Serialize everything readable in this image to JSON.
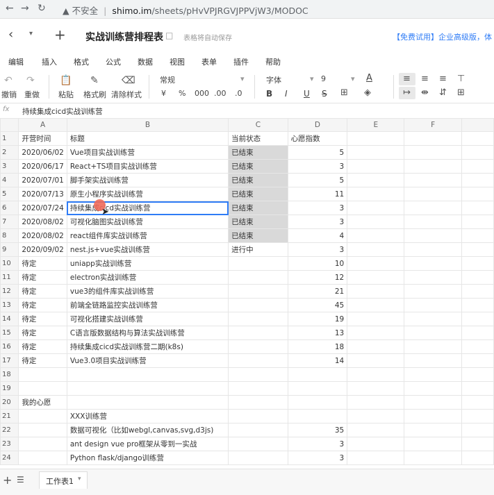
{
  "browser": {
    "back_icon": "arrow-left",
    "forward_icon": "arrow-right",
    "reload_icon": "reload",
    "security_icon": "warning",
    "security_label": "不安全",
    "separator": "|",
    "url_host": "shimo.im",
    "url_path": "/sheets/pHvVPJRGVJPPVjW3/MODOC"
  },
  "doc": {
    "back": "‹",
    "dropdown": "▾",
    "add": "+",
    "title": "实战训练营排程表",
    "autosave": "表格将自动保存",
    "promo": "【免费试用】企业高级版，体"
  },
  "menu": [
    "编辑",
    "插入",
    "格式",
    "公式",
    "数据",
    "视图",
    "表单",
    "插件",
    "帮助"
  ],
  "toolbar": {
    "undo": "撤销",
    "redo": "重做",
    "paste": "粘贴",
    "format_painter": "格式刷",
    "clear_format": "清除样式",
    "number_format": "常规",
    "currency": "¥",
    "percent": "%",
    "thousands": "000",
    "dec_less": ".00",
    "dec_more": ".0",
    "font": "字体",
    "font_size": "9",
    "bold": "B",
    "italic": "I",
    "underline": "U",
    "strike": "S",
    "font_color": "A"
  },
  "formula": {
    "fx": "fx",
    "content": "持续集成cicd实战训练营"
  },
  "columns": [
    "A",
    "B",
    "C",
    "D",
    "E",
    "F"
  ],
  "rows": [
    {
      "n": "1",
      "a": "开营时间",
      "b": "标题",
      "c": "当前状态",
      "d": "心愿指数"
    },
    {
      "n": "2",
      "a": "2020/06/02",
      "b": " Vue项目实战训练营",
      "c": "已结束",
      "d": "5"
    },
    {
      "n": "3",
      "a": "2020/06/17",
      "b": "React+TS项目实战训练营",
      "c": "已结束",
      "d": "3"
    },
    {
      "n": "4",
      "a": "2020/07/01",
      "b": "脚手架实战训练营",
      "c": "已结束",
      "d": "5"
    },
    {
      "n": "5",
      "a": "2020/07/13",
      "b": "原生小程序实战训练营",
      "c": "已结束",
      "d": "11"
    },
    {
      "n": "6",
      "a": "2020/07/24",
      "b": "持续集成cicd实战训练营",
      "c": "已结束",
      "d": "3"
    },
    {
      "n": "7",
      "a": "2020/08/02",
      "b": "可视化脑图实战训练营",
      "c": "已结束",
      "d": "3"
    },
    {
      "n": "8",
      "a": "2020/08/02",
      "b": "react组件库实战训练营",
      "c": "已结束",
      "d": "4"
    },
    {
      "n": "9",
      "a": "2020/09/02",
      "b": "nest.js+vue实战训练营",
      "c": "进行中",
      "d": "3"
    },
    {
      "n": "10",
      "a": "待定",
      "b": "uniapp实战训练营",
      "c": "",
      "d": "10"
    },
    {
      "n": "11",
      "a": "待定",
      "b": "electron实战训练营",
      "c": "",
      "d": "12"
    },
    {
      "n": "12",
      "a": "待定",
      "b": "vue3的组件库实战训练营",
      "c": "",
      "d": "21"
    },
    {
      "n": "13",
      "a": "待定",
      "b": "前端全链路监控实战训练营",
      "c": "",
      "d": "45"
    },
    {
      "n": "14",
      "a": "待定",
      "b": "可视化搭建实战训练营",
      "c": "",
      "d": "19"
    },
    {
      "n": "15",
      "a": "待定",
      "b": "C语言版数据结构与算法实战训练营",
      "c": "",
      "d": "13"
    },
    {
      "n": "16",
      "a": "待定",
      "b": "持续集成cicd实战训练营二期(k8s)",
      "c": "",
      "d": "18"
    },
    {
      "n": "17",
      "a": "待定",
      "b": "Vue3.0项目实战训练营",
      "c": "",
      "d": "14"
    },
    {
      "n": "18",
      "a": "",
      "b": "",
      "c": "",
      "d": ""
    },
    {
      "n": "19",
      "a": "",
      "b": "",
      "c": "",
      "d": ""
    },
    {
      "n": "20",
      "a": "我的心愿",
      "b": "",
      "c": "",
      "d": ""
    },
    {
      "n": "21",
      "a": "",
      "b": "XXX训练营",
      "c": "",
      "d": ""
    },
    {
      "n": "22",
      "a": "",
      "b": "数据可视化（比如webgl,canvas,svg,d3js)",
      "c": "",
      "d": "35"
    },
    {
      "n": "23",
      "a": "",
      "b": "ant design vue pro框架从零到一实战",
      "c": "",
      "d": "3"
    },
    {
      "n": "24",
      "a": "",
      "b": "Python flask/django训练营",
      "c": "",
      "d": "3"
    }
  ],
  "bottom": {
    "add": "+",
    "list": "☰",
    "sheet_tab": "工作表1",
    "tab_arrow": "▾"
  },
  "colors": {
    "accent": "#2f7cf6",
    "done_bg": "#d9d9d9",
    "promo": "#2f7cf6",
    "cursor": "#f06a5a"
  }
}
